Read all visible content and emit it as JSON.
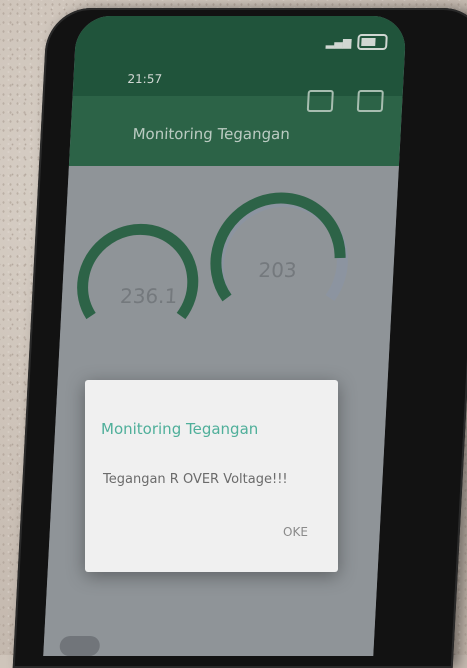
{
  "status_bar": {
    "time": "21:57",
    "icons_left": "signal-icon",
    "icons_right": "battery-icon"
  },
  "app_bar": {
    "title": "Monitoring Tegangan"
  },
  "gauges": [
    {
      "value": "236.1"
    },
    {
      "value": "203"
    }
  ],
  "dialog": {
    "title": "Monitoring Tegangan",
    "message": "Tegangan R OVER Voltage!!!",
    "ok_label": "OKE"
  },
  "colors": {
    "app_bar": "#2d6b4a",
    "dialog_title": "#4faf9a",
    "gauge_arc": "#2e6b4b"
  }
}
